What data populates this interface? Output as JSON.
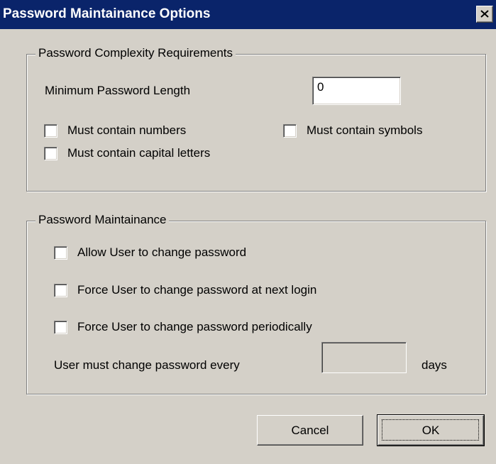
{
  "window": {
    "title": "Password Maintainance Options",
    "titlebar_color": "#0a246a",
    "close_icon": "close-icon"
  },
  "complexity": {
    "legend": "Password Complexity Requirements",
    "min_length_label": "Minimum Password Length",
    "min_length_value": "0",
    "numbers_label": "Must contain numbers",
    "numbers_checked": false,
    "symbols_label": "Must contain symbols",
    "symbols_checked": false,
    "capitals_label": "Must contain capital letters",
    "capitals_checked": false
  },
  "maintenance": {
    "legend": "Password Maintainance",
    "allow_change_label": "Allow User to change password",
    "allow_change_checked": false,
    "force_next_login_label": "Force User to change password at next login",
    "force_next_login_checked": false,
    "force_periodic_label": "Force User to change password periodically",
    "force_periodic_checked": false,
    "every_label": "User must change password every",
    "every_value": "",
    "days_label": "days"
  },
  "buttons": {
    "cancel": "Cancel",
    "ok": "OK"
  }
}
